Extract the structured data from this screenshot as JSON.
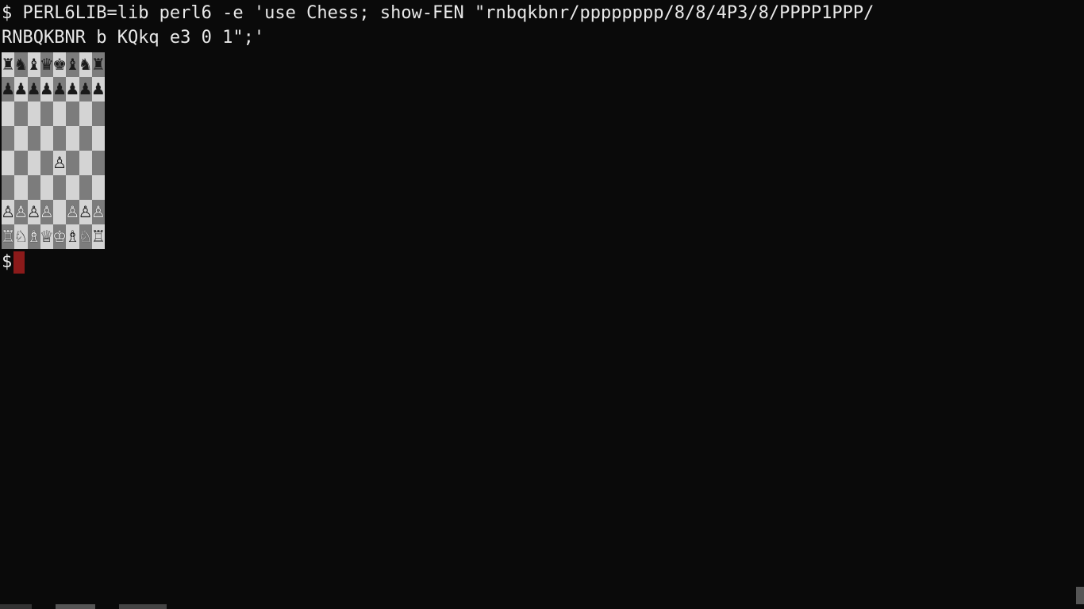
{
  "command": {
    "prompt1": "$ ",
    "line1": "PERL6LIB=lib perl6 -e 'use Chess; show-FEN \"rnbqkbnr/pppppppp/8/8/4P3/8/PPPP1PPP/",
    "line2": "RNBQKBNR b KQkq e3 0 1\";'"
  },
  "chess": {
    "fen": "rnbqkbnr/pppppppp/8/8/4P3/8/PPPP1PPP/RNBQKBNR",
    "board": [
      [
        "r",
        "n",
        "b",
        "q",
        "k",
        "b",
        "n",
        "r"
      ],
      [
        "p",
        "p",
        "p",
        "p",
        "p",
        "p",
        "p",
        "p"
      ],
      [
        "",
        "",
        "",
        "",
        "",
        "",
        "",
        ""
      ],
      [
        "",
        "",
        "",
        "",
        "",
        "",
        "",
        ""
      ],
      [
        "",
        "",
        "",
        "",
        "P",
        "",
        "",
        ""
      ],
      [
        "",
        "",
        "",
        "",
        "",
        "",
        "",
        ""
      ],
      [
        "P",
        "P",
        "P",
        "P",
        "",
        "P",
        "P",
        "P"
      ],
      [
        "R",
        "N",
        "B",
        "Q",
        "K",
        "B",
        "N",
        "R"
      ]
    ],
    "glyphs": {
      "K": "♔",
      "Q": "♕",
      "R": "♖",
      "B": "♗",
      "N": "♘",
      "P": "♙",
      "k": "♚",
      "q": "♛",
      "r": "♜",
      "b": "♝",
      "n": "♞",
      "p": "♟"
    }
  },
  "prompt2": "$ ",
  "colors": {
    "light_square": "#d4d4d4",
    "dark_square": "#7c7c7c",
    "cursor": "#8b1a1a",
    "bg": "#0a0a0a",
    "fg": "#e8e8e8"
  }
}
